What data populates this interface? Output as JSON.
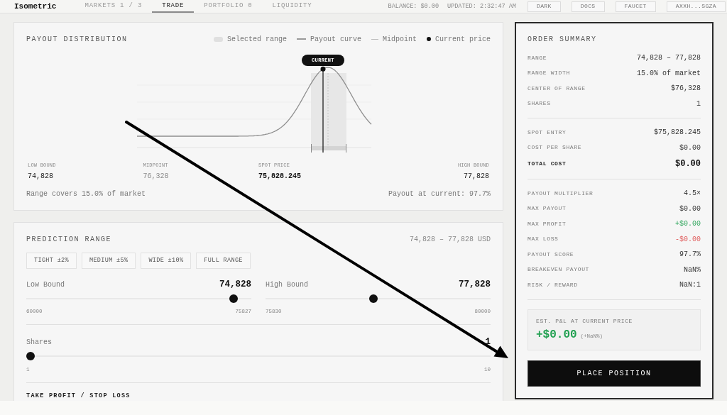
{
  "header": {
    "logo": "Isometric",
    "tabs": [
      {
        "label": "MARKETS 1 / 3",
        "selected": false
      },
      {
        "label": "TRADE",
        "selected": true
      },
      {
        "label": "PORTFOLIO 0",
        "selected": false
      },
      {
        "label": "LIQUIDITY",
        "selected": false
      }
    ],
    "status": [
      "BALANCE: $0.00",
      "UPDATED: 2:32:47 AM"
    ],
    "buttons": [
      "DARK",
      "DOCS",
      "FAUCET",
      "AXXH...SGZA"
    ]
  },
  "payout_distribution": {
    "title": "PAYOUT DISTRIBUTION",
    "legend": [
      {
        "kind": "band",
        "label": "Selected range"
      },
      {
        "kind": "curve",
        "label": "Payout curve"
      },
      {
        "kind": "midpoint",
        "label": "Midpoint"
      },
      {
        "kind": "dot",
        "label": "Current price"
      }
    ],
    "marker_label": "CURRENT",
    "stats": [
      {
        "kind": "bound",
        "label": "LOW BOUND",
        "value": "74,828"
      },
      {
        "kind": "midpoint",
        "label": "MIDPOINT",
        "value": "76,328"
      },
      {
        "kind": "spot",
        "label": "SPOT PRICE",
        "value": "75,828.245"
      },
      {
        "kind": "bound",
        "label": "HIGH BOUND",
        "value": "77,828"
      }
    ],
    "coverage": "Range covers 15.0% of market",
    "payout_at_current": "Payout at current: 97.7%"
  },
  "prediction_range": {
    "title": "PREDICTION RANGE",
    "range_text": "74,828 – 77,828 USD",
    "presets": [
      "TIGHT ±2%",
      "MEDIUM ±5%",
      "WIDE ±10%",
      "FULL RANGE"
    ],
    "bounds": [
      {
        "label": "Low Bound",
        "value": "74,828",
        "level": 0.937,
        "min": "60000",
        "max": "75827"
      },
      {
        "label": "High Bound",
        "value": "77,828",
        "level": 0.479,
        "min": "75830",
        "max": "80000"
      }
    ],
    "shares": {
      "label": "Shares",
      "value": "1",
      "level": 0,
      "min": "1",
      "max": "10"
    },
    "section_title": "TAKE PROFIT / STOP LOSS"
  },
  "order_summary": {
    "title": "ORDER SUMMARY",
    "groups": [
      [
        {
          "kind": "normal",
          "label": "RANGE",
          "value": "74,828 – 77,828"
        },
        {
          "kind": "normal",
          "label": "RANGE WIDTH",
          "value": "15.0% of market"
        },
        {
          "kind": "normal",
          "label": "CENTER OF RANGE",
          "value": "$76,328"
        },
        {
          "kind": "normal",
          "label": "SHARES",
          "value": "1"
        }
      ],
      [
        {
          "kind": "normal",
          "label": "SPOT ENTRY",
          "value": "$75,828.245"
        },
        {
          "kind": "normal",
          "label": "COST PER SHARE",
          "value": "$0.00"
        },
        {
          "kind": "total",
          "label": "TOTAL COST",
          "value": "$0.00"
        }
      ],
      [
        {
          "kind": "normal",
          "label": "PAYOUT MULTIPLIER",
          "value": "4.5×"
        },
        {
          "kind": "normal",
          "label": "MAX PAYOUT",
          "value": "$0.00"
        },
        {
          "kind": "gain",
          "label": "MAX PROFIT",
          "value": "+$0.00"
        },
        {
          "kind": "loss",
          "label": "MAX LOSS",
          "value": "-$0.00"
        },
        {
          "kind": "normal",
          "label": "PAYOUT SCORE",
          "value": "97.7%"
        },
        {
          "kind": "normal",
          "label": "BREAKEVEN PAYOUT",
          "value": "NaN%"
        },
        {
          "kind": "normal",
          "label": "RISK / REWARD",
          "value": "NaN:1"
        }
      ]
    ],
    "pnl": {
      "kind": "gain",
      "label": "EST. P&L AT CURRENT PRICE",
      "value": "+$0.00",
      "percent": "(+NaN%)"
    },
    "button": "PLACE POSITION"
  }
}
